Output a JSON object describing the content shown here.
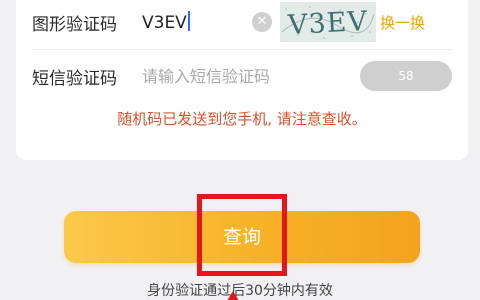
{
  "form": {
    "captcha_label": "图形验证码",
    "captcha_input_value": "V3EV",
    "captcha_image_text": "V3EV",
    "refresh_label": "换一换",
    "sms_label": "短信验证码",
    "sms_placeholder": "请输入短信验证码",
    "countdown": "58",
    "notice": "随机码已发送到您手机, 请注意查收。"
  },
  "actions": {
    "query_label": "查询"
  },
  "footer": {
    "note": "身份验证通过后30分钟内有效"
  },
  "colors": {
    "accent_orange": "#f7b227",
    "notice_red": "#e04f2c",
    "highlight_red": "#e8141b"
  }
}
